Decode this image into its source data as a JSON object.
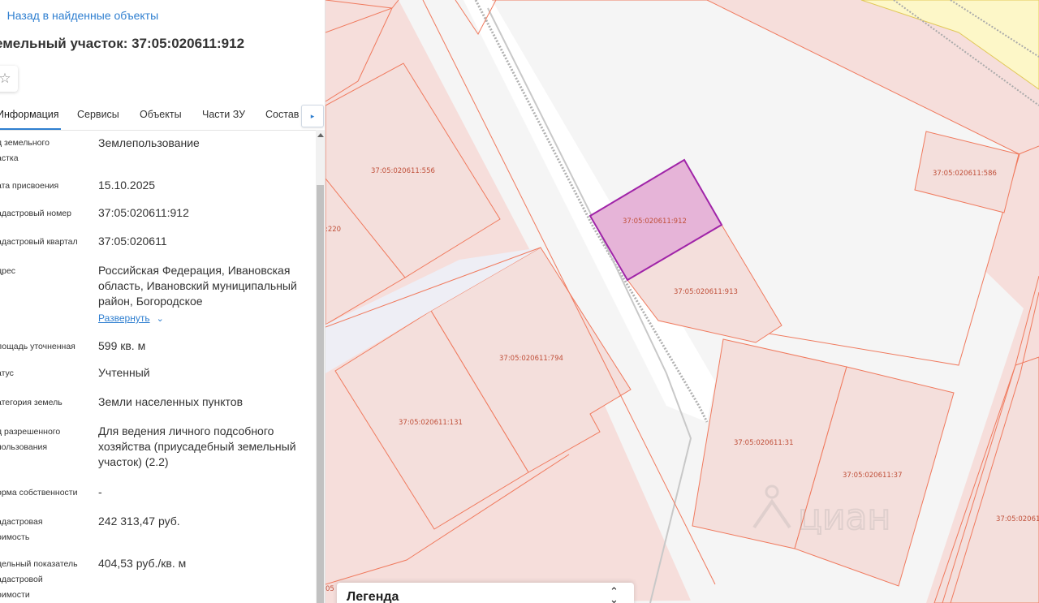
{
  "nav": {
    "back_label": "Назад в найденные объекты",
    "back_icon": "chevron-left-icon"
  },
  "object": {
    "title": "емельный участок: 37:05:020611:912"
  },
  "favorite": {
    "icon": "star-icon",
    "glyph": "☆"
  },
  "tabs": [
    {
      "label": "Информация",
      "active": true
    },
    {
      "label": "Сервисы",
      "active": false
    },
    {
      "label": "Объекты",
      "active": false
    },
    {
      "label": "Части ЗУ",
      "active": false
    },
    {
      "label": "Состав",
      "active": false
    }
  ],
  "tabs_next": {
    "glyph": "▸",
    "icon": "chevron-right-icon"
  },
  "info_rows": [
    {
      "label": "д земельного\nастка",
      "value": "Землепользование"
    },
    {
      "label": "ата присвоения",
      "value": "15.10.2025"
    },
    {
      "label": "адастровый номер",
      "value": "37:05:020611:912"
    },
    {
      "label": "адастровый квартал",
      "value": "37:05:020611"
    },
    {
      "label": "дрес",
      "value": "Российская Федерация, Ивановская область, Ивановский муниципальный район, Богородское",
      "expand_label": "Развернуть",
      "expand_glyph": "⌄"
    },
    {
      "label": "лощадь уточненная",
      "value": "599 кв. м"
    },
    {
      "label": "атус",
      "value": "Учтенный"
    },
    {
      "label": "атегория земель",
      "value": "Земли населенных пунктов"
    },
    {
      "label": "д разрешенного\nпользования",
      "value": "Для ведения личного подсобного хозяйства (приусадебный земельный участок) (2.2)"
    },
    {
      "label": "орма собственности",
      "value": "-"
    },
    {
      "label": "адастровая\nоимость",
      "value": "242 313,47 руб."
    },
    {
      "label": "дельный показатель\nадастровой\nоимости",
      "value": "404,53 руб./кв. м"
    }
  ],
  "map": {
    "parcel_labels": [
      "37:05:020611:556",
      "37:05:020611:912",
      "37:05:020611:586",
      ":220",
      "37:05:020611:913",
      "37:05:020611:794",
      "37:05:020611:131",
      "37:05:020611:31",
      "37:05:020611:37",
      "37:05:02061",
      "05"
    ],
    "selected_parcel": "37:05:020611:912",
    "colors": {
      "parcel_fill": "#f6dedb",
      "parcel_stroke": "#f07a5e",
      "selected_fill": "#e6b4d8",
      "selected_stroke": "#a024a8",
      "zone_yellow": "#fdf7c8"
    },
    "watermark": "циан"
  },
  "legend": {
    "title": "Легенда",
    "toggle_glyph": "⌃\n⌄"
  }
}
